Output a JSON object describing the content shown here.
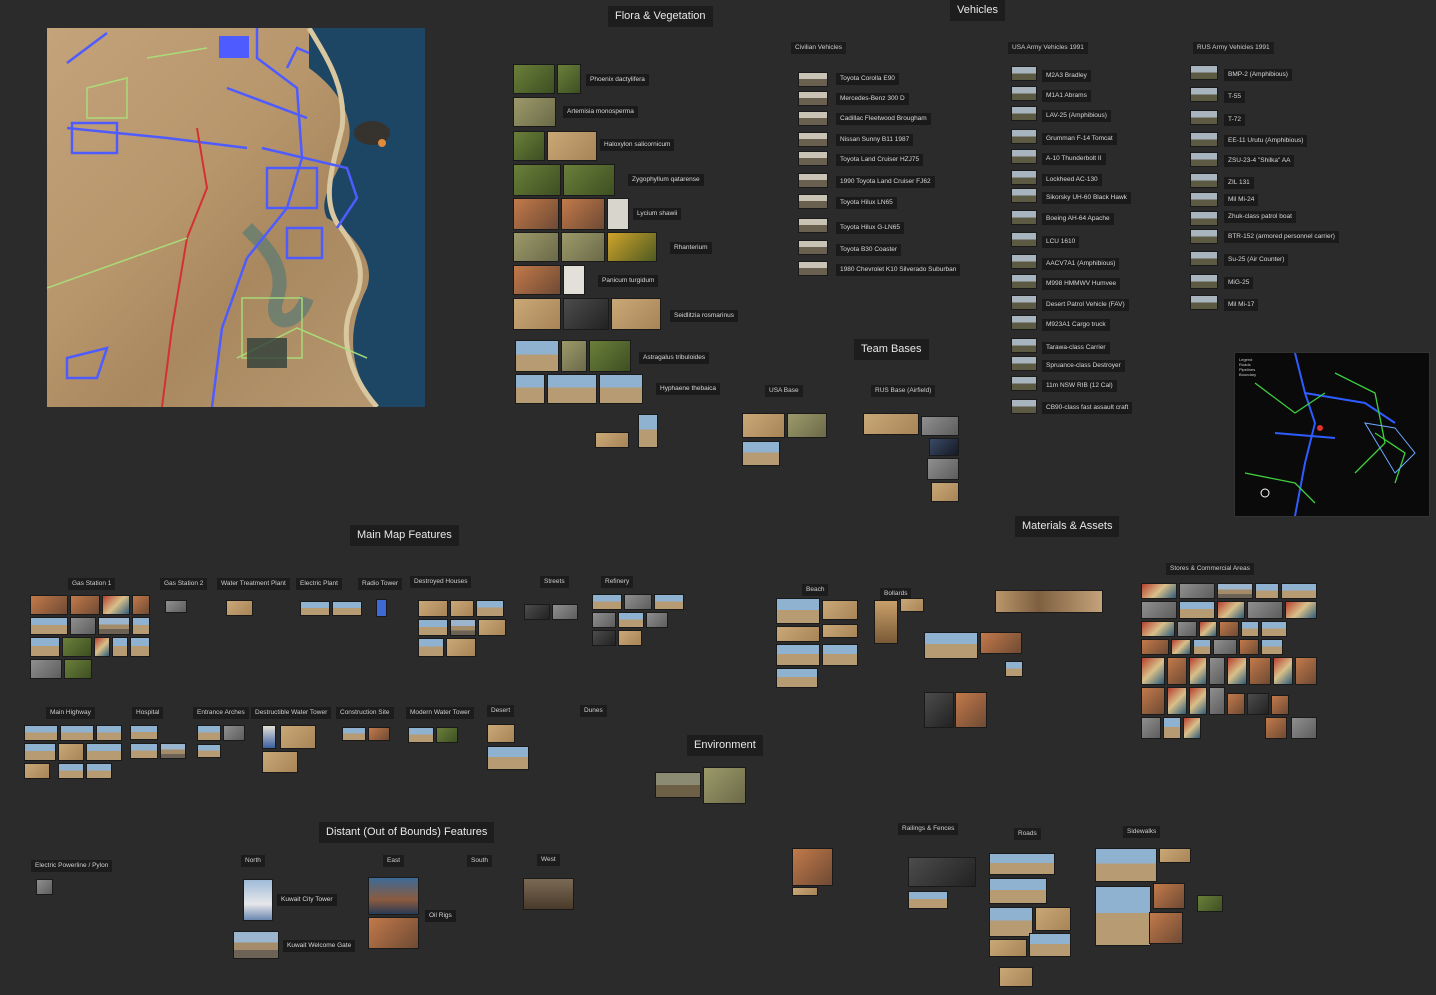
{
  "sections": {
    "flora": "Flora & Vegetation",
    "vehicles": "Vehicles",
    "team_bases": "Team Bases",
    "main_map": "Main Map Features",
    "materials": "Materials & Assets",
    "environment": "Environment",
    "distant": "Distant (Out of Bounds) Features"
  },
  "flora_labels": [
    "Phoenix dactylifera",
    "Artemisia monosperma",
    "Haloxylon salicornicum",
    "Zygophyllum qatarense",
    "Lycium shawii",
    "Rhanterium",
    "Panicum turgidum",
    "Seidlitzia rosmarinus",
    "Astragalus tribuloides",
    "Hyphaene thebaica"
  ],
  "vehicles": {
    "civilian_title": "Civilian Vehicles",
    "civilian": [
      "Toyota Corolla E90",
      "Mercedes-Benz 300 D",
      "Cadillac Fleetwood Brougham",
      "Nissan Sunny B11 1987",
      "Toyota Land Cruiser HZJ75",
      "1990 Toyota Land Cruiser FJ62",
      "Toyota Hilux LN65",
      "Toyota Hilux G-LN65",
      "Toyota B30 Coaster",
      "1980 Chevrolet K10 Silverado Suburban"
    ],
    "usa_title": "USA Army Vehicles 1991",
    "usa": [
      "M2A3 Bradley",
      "M1A1 Abrams",
      "LAV-25 (Amphibious)",
      "Grumman F-14 Tomcat",
      "A-10 Thunderbolt II",
      "Lockheed AC-130",
      "Sikorsky UH-60 Black Hawk",
      "Boeing AH-64 Apache",
      "LCU 1610",
      "AACV7A1 (Amphibious)",
      "M998 HMMWV Humvee",
      "Desert Patrol Vehicle (FAV)",
      "M923A1 Cargo truck",
      "Tarawa-class Carrier",
      "Spruance-class Destroyer",
      "11m NSW RIB (12 Cal)",
      "CB90-class fast assault craft"
    ],
    "rus_title": "RUS Army Vehicles 1991",
    "rus": [
      "BMP-2 (Amphibious)",
      "T-55",
      "T-72",
      "EE-11 Urutu (Amphibious)",
      "ZSU-23-4 \"Shilka\" AA",
      "ZIL 131",
      "Mil Mi-24",
      "Zhuk-class patrol boat",
      "BTR-152 (armored personnel carrier)",
      "Su-25 (Air Counter)",
      "MiG-25",
      "Mil Mi-17"
    ]
  },
  "bases": {
    "usa": "USA Base",
    "rus": "RUS Base (Airfield)"
  },
  "map_features": [
    "Gas Station 1",
    "Gas Station 2",
    "Water Treatment Plant",
    "Electric Plant",
    "Radio Tower",
    "Destroyed Houses",
    "Streets",
    "Refinery",
    "Main Highway",
    "Hospital",
    "Entrance Arches",
    "Destructible Water Tower",
    "Construction Site",
    "Modern Water Tower",
    "Desert",
    "Dunes"
  ],
  "materials": {
    "beach": "Beach",
    "bollards": "Bollards",
    "stores": "Stores & Commercial Areas",
    "railings": "Railings & Fences",
    "roads": "Roads",
    "sidewalks": "Sidewalks"
  },
  "distant": {
    "electric": "Electric Powerline / Pylon",
    "north": "North",
    "east": "East",
    "south": "South",
    "west": "West",
    "kuwait_towers": "Kuwait City Tower",
    "welcome_gate": "Kuwait Welcome Gate",
    "bridge": "Oil Rigs"
  },
  "map_legend": [
    "Legend",
    "Roads",
    "Pipelines",
    "Boundary"
  ]
}
